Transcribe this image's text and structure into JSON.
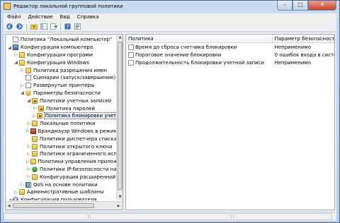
{
  "window": {
    "title": "Редактор локальной групповой политики"
  },
  "menu": [
    "Файл",
    "Действие",
    "Вид",
    "Справка"
  ],
  "tree": [
    {
      "level": 0,
      "expander": "",
      "icon": "doc",
      "label": "Политика \"Локальный компьютер\""
    },
    {
      "level": 0,
      "expander": "◢",
      "icon": "pc",
      "label": "Конфигурация компьютера"
    },
    {
      "level": 1,
      "expander": "▷",
      "icon": "folder",
      "label": "Конфигурация программ"
    },
    {
      "level": 1,
      "expander": "◢",
      "icon": "folder",
      "label": "Конфигурация Windows"
    },
    {
      "level": 2,
      "expander": "▷",
      "icon": "folder",
      "label": "Политика разрешения имен"
    },
    {
      "level": 2,
      "expander": "",
      "icon": "doc",
      "label": "Сценарии (запуск/завершение)"
    },
    {
      "level": 2,
      "expander": "▷",
      "icon": "doc",
      "label": "Развернутые принтеры"
    },
    {
      "level": 2,
      "expander": "◢",
      "icon": "shield",
      "label": "Параметры безопасности"
    },
    {
      "level": 3,
      "expander": "◢",
      "icon": "lockfolder",
      "label": "Политики учетных записей"
    },
    {
      "level": 4,
      "expander": "▷",
      "icon": "lockfolder",
      "label": "Политика паролей"
    },
    {
      "level": 4,
      "expander": "▷",
      "icon": "lockfolder",
      "label": "Политика блокировки учет",
      "focus": true
    },
    {
      "level": 3,
      "expander": "▷",
      "icon": "folder",
      "label": "Локальные политики"
    },
    {
      "level": 3,
      "expander": "▷",
      "icon": "fw",
      "label": "Брандмауэр Windows в режим"
    },
    {
      "level": 3,
      "expander": "",
      "icon": "folder",
      "label": "Политики диспетчера списка"
    },
    {
      "level": 3,
      "expander": "▷",
      "icon": "folder",
      "label": "Политики открытого ключа"
    },
    {
      "level": 3,
      "expander": "▷",
      "icon": "folder",
      "label": "Политики ограниченного исп"
    },
    {
      "level": 3,
      "expander": "▷",
      "icon": "folder",
      "label": "Политики управления прилож"
    },
    {
      "level": 3,
      "expander": "▷",
      "icon": "net",
      "label": "Политики IP-безопасности на"
    },
    {
      "level": 3,
      "expander": "▷",
      "icon": "folder",
      "label": "Конфигурация расширенной"
    },
    {
      "level": 2,
      "expander": "▷",
      "icon": "chart",
      "label": "QoS на основе политики"
    },
    {
      "level": 1,
      "expander": "▷",
      "icon": "folder",
      "label": "Административные шаблоны"
    },
    {
      "level": 0,
      "expander": "◢",
      "icon": "user",
      "label": "Конфигурация пользователя"
    }
  ],
  "list": {
    "columns": [
      "Политика",
      "Параметр безопасности"
    ],
    "rows": [
      {
        "policy": "Время до сброса счетчика блокировки",
        "value": "Неприменимо"
      },
      {
        "policy": "Пороговое значение блокировки",
        "value": "0 ошибок входа в систе..."
      },
      {
        "policy": "Продолжительность блокировки учетной записи",
        "value": "Неприменимо"
      }
    ]
  }
}
